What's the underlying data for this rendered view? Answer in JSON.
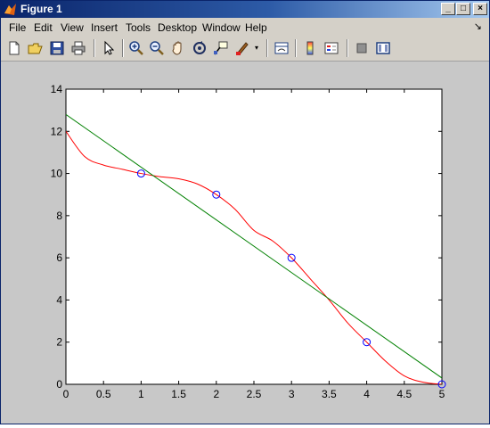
{
  "window": {
    "title": "Figure 1",
    "buttons": {
      "minimize": "_",
      "maximize": "□",
      "close": "×"
    }
  },
  "menu": {
    "items": [
      "File",
      "Edit",
      "View",
      "Insert",
      "Tools",
      "Desktop",
      "Window",
      "Help"
    ],
    "dock_arrow": "↘"
  },
  "toolbar": {
    "icons": [
      "new-figure-icon",
      "open-file-icon",
      "save-icon",
      "print-icon",
      "edit-plot-arrow-icon",
      "zoom-in-icon",
      "zoom-out-icon",
      "pan-hand-icon",
      "rotate-3d-icon",
      "data-cursor-icon",
      "brush-icon",
      "brush-dropdown-icon",
      "link-plot-icon",
      "colorbar-icon",
      "legend-icon",
      "hide-plot-tools-icon",
      "show-plot-tools-icon"
    ]
  },
  "chart_data": {
    "type": "line",
    "title": "",
    "xlabel": "",
    "ylabel": "",
    "xlim": [
      0,
      5
    ],
    "ylim": [
      0,
      14
    ],
    "xticks": [
      "0",
      "0.5",
      "1",
      "1.5",
      "2",
      "2.5",
      "3",
      "3.5",
      "4",
      "4.5",
      "5"
    ],
    "yticks": [
      "0",
      "2",
      "4",
      "6",
      "8",
      "10",
      "12",
      "14"
    ],
    "grid": false,
    "legend": "none",
    "series": [
      {
        "kind": "markers",
        "color": "#0000ff",
        "marker": "circle",
        "x": [
          1,
          2,
          3,
          4,
          5
        ],
        "y": [
          10,
          9,
          6,
          2,
          0
        ]
      },
      {
        "kind": "line",
        "color": "#ff0000",
        "x": [
          0,
          0.25,
          0.5,
          0.75,
          1,
          1.25,
          1.5,
          1.75,
          2,
          2.25,
          2.5,
          2.75,
          3,
          3.25,
          3.5,
          3.75,
          4,
          4.25,
          4.5,
          4.75,
          5
        ],
        "y": [
          12,
          10.8,
          10.4,
          10.2,
          10,
          9.85,
          9.75,
          9.5,
          9,
          8.3,
          7.3,
          6.8,
          6,
          5.0,
          4.0,
          2.9,
          2,
          1.1,
          0.4,
          0.1,
          0
        ]
      },
      {
        "kind": "line",
        "color": "#008000",
        "x": [
          0,
          5
        ],
        "y": [
          12.8,
          0.3
        ]
      }
    ]
  }
}
